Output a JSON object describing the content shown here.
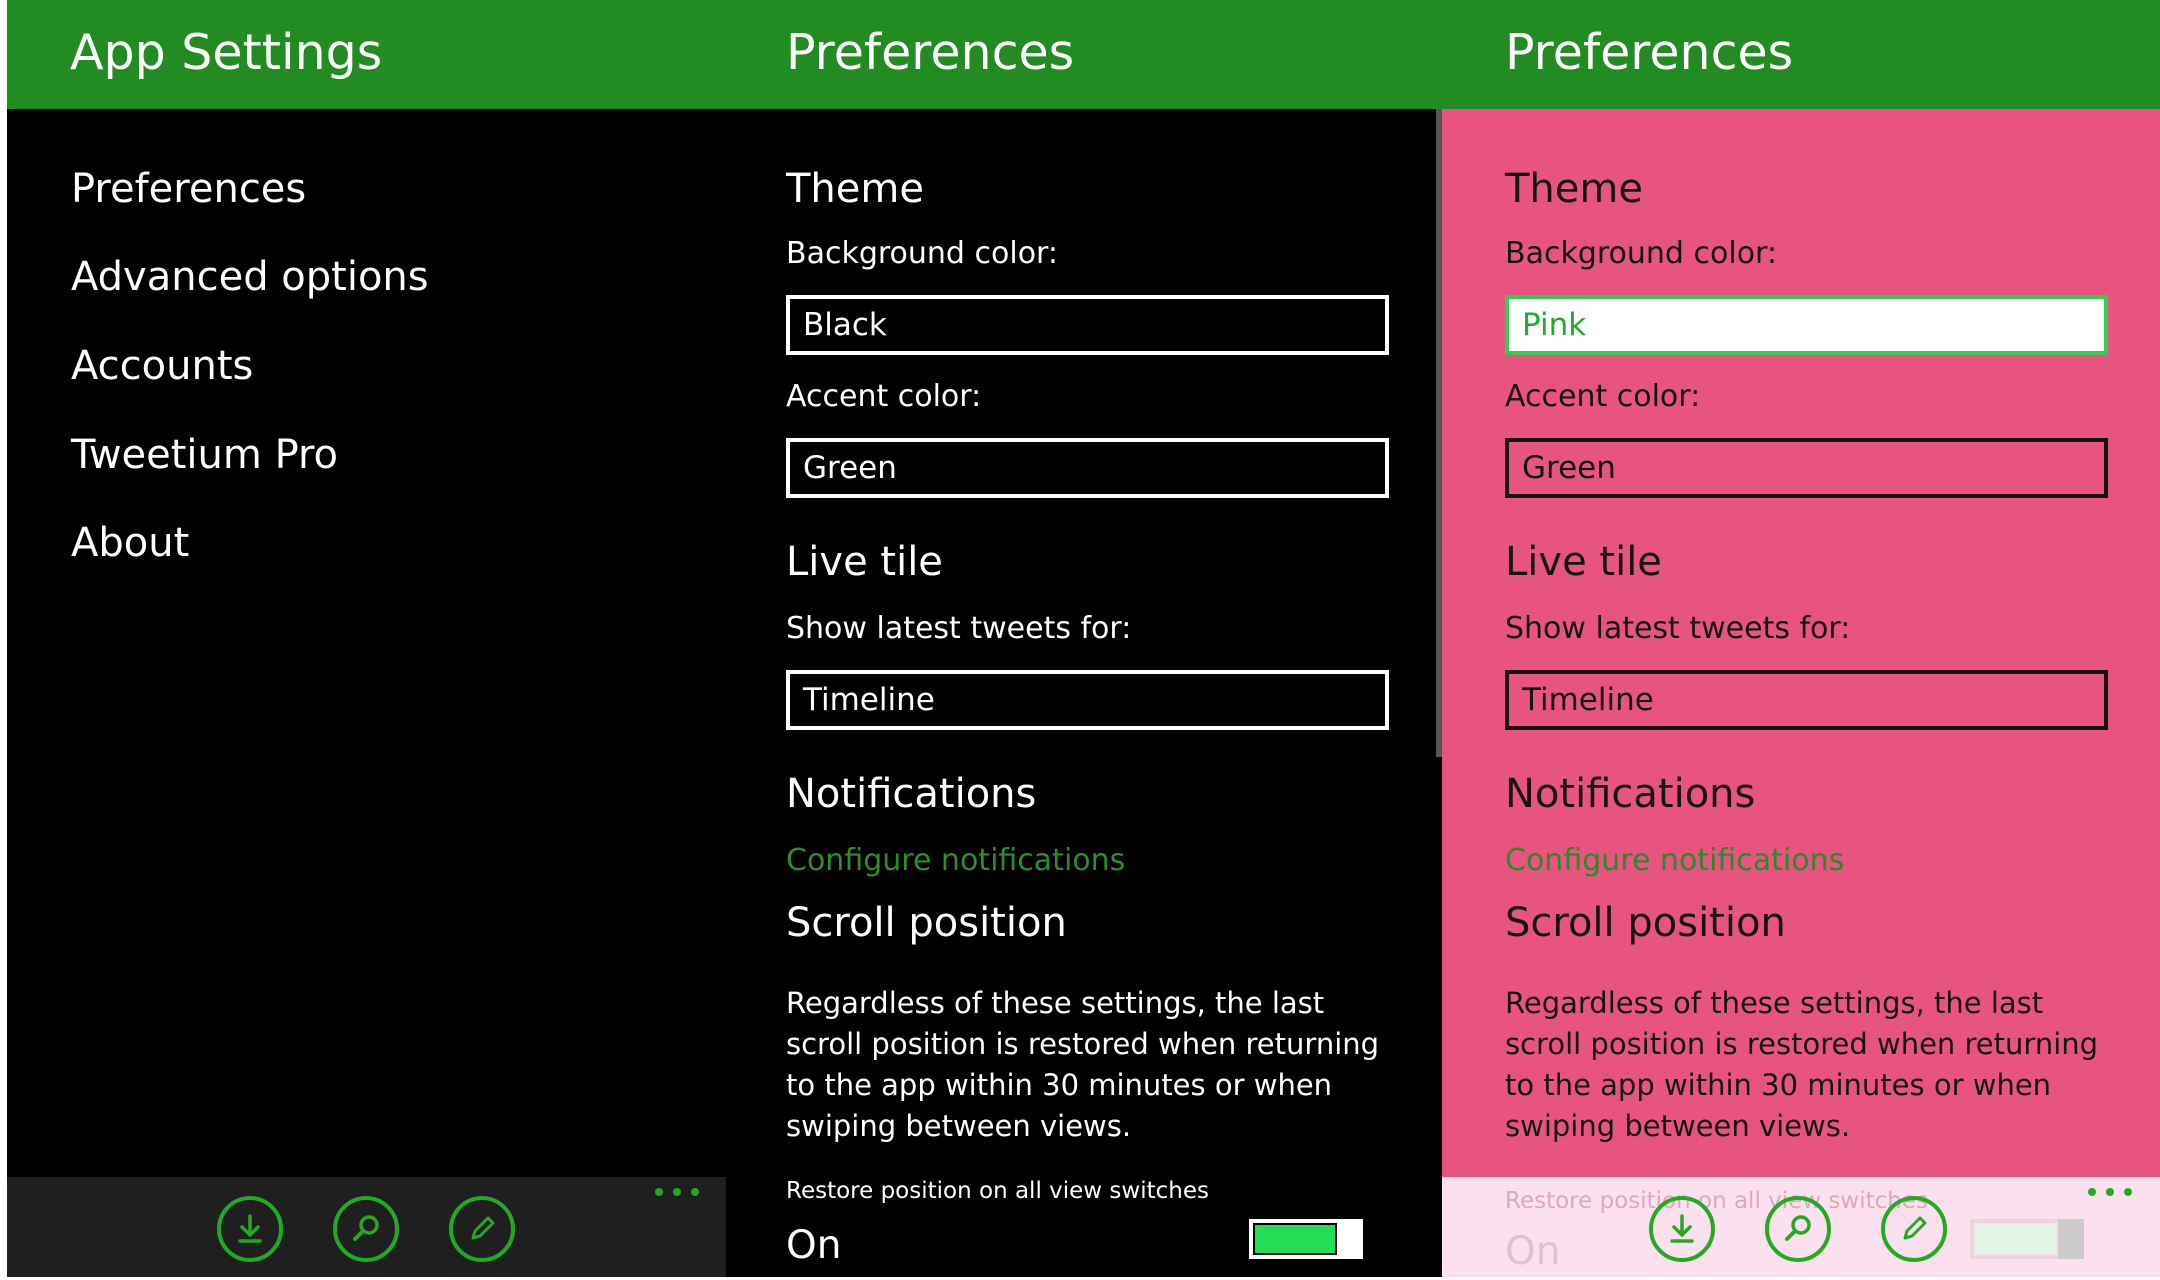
{
  "colors": {
    "accent": "#228b22",
    "pink_background": "#e75480",
    "toggle_on": "#22dd55"
  },
  "panel_left": {
    "header_title": "App Settings",
    "menu": [
      {
        "label": "Preferences"
      },
      {
        "label": "Advanced options"
      },
      {
        "label": "Accounts"
      },
      {
        "label": "Tweetium Pro"
      },
      {
        "label": "About"
      }
    ],
    "appbar": {
      "icons": [
        "download-icon",
        "search-icon",
        "edit-icon"
      ],
      "more": "more-options-icon"
    }
  },
  "panel_dark": {
    "header_title": "Preferences",
    "theme": {
      "title": "Theme",
      "background_label": "Background color:",
      "background_value": "Black",
      "accent_label": "Accent color:",
      "accent_value": "Green"
    },
    "live_tile": {
      "title": "Live tile",
      "label": "Show latest tweets for:",
      "value": "Timeline"
    },
    "notifications": {
      "title": "Notifications",
      "link": "Configure notifications"
    },
    "scroll": {
      "title": "Scroll position",
      "description": "Regardless of these settings, the last scroll position is restored when returning to the app within 30 minutes or when swiping between views.",
      "restore_label": "Restore position on all view switches",
      "restore_state": "On",
      "restore_on": true
    }
  },
  "panel_pink": {
    "header_title": "Preferences",
    "theme": {
      "title": "Theme",
      "background_label": "Background color:",
      "background_value": "Pink",
      "accent_label": "Accent color:",
      "accent_value": "Green"
    },
    "live_tile": {
      "title": "Live tile",
      "label": "Show latest tweets for:",
      "value": "Timeline"
    },
    "notifications": {
      "title": "Notifications",
      "link": "Configure notifications"
    },
    "scroll": {
      "title": "Scroll position",
      "description": "Regardless of these settings, the last scroll position is restored when returning to the app within 30 minutes or when swiping between views.",
      "restore_label": "Restore position on all view switches",
      "restore_state": "On",
      "restore_on": true
    },
    "appbar": {
      "icons": [
        "download-icon",
        "search-icon",
        "edit-icon"
      ],
      "more": "more-options-icon"
    }
  }
}
